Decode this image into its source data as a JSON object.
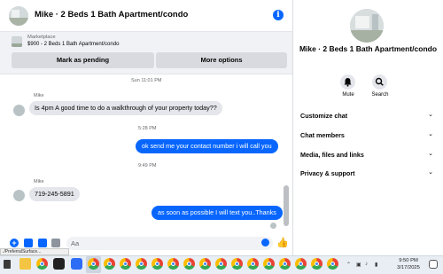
{
  "header": {
    "title": "Mike · 2 Beds 1 Bath Apartment/condo",
    "info_icon": "info-icon"
  },
  "marketplace": {
    "label": "Marketplace",
    "listing": "$900 - 2 Beds 1 Bath Apartment/condo",
    "mark_pending_label": "Mark as pending",
    "more_options_label": "More options"
  },
  "messages": {
    "ts1": "Sun 11:01 PM",
    "sender1": "Mike",
    "m1": "Is 4pm A good time to do a walkthrough of your property today??",
    "ts2": "5:28 PM",
    "m2": "ok send me your contact number i will call you",
    "ts3": "9:49 PM",
    "sender2": "Mike",
    "m3": "719-245-5891",
    "m4": "as soon as possible I will text you..Thanks"
  },
  "composer": {
    "placeholder": "Aa"
  },
  "status_tip": "./PreferralSurface...",
  "panel": {
    "title": "Mike · 2 Beds 1 Bath Apartment/condo",
    "mute_label": "Mute",
    "search_label": "Search",
    "menu": {
      "customize": "Customize chat",
      "members": "Chat members",
      "media": "Media, files and links",
      "privacy": "Privacy & support"
    }
  },
  "taskbar": {
    "time": "9:50 PM",
    "date": "3/17/2025"
  },
  "colors": {
    "accent": "#0866ff",
    "bubble_in": "#e4e6eb",
    "bg_bar": "#f0f2f5"
  }
}
